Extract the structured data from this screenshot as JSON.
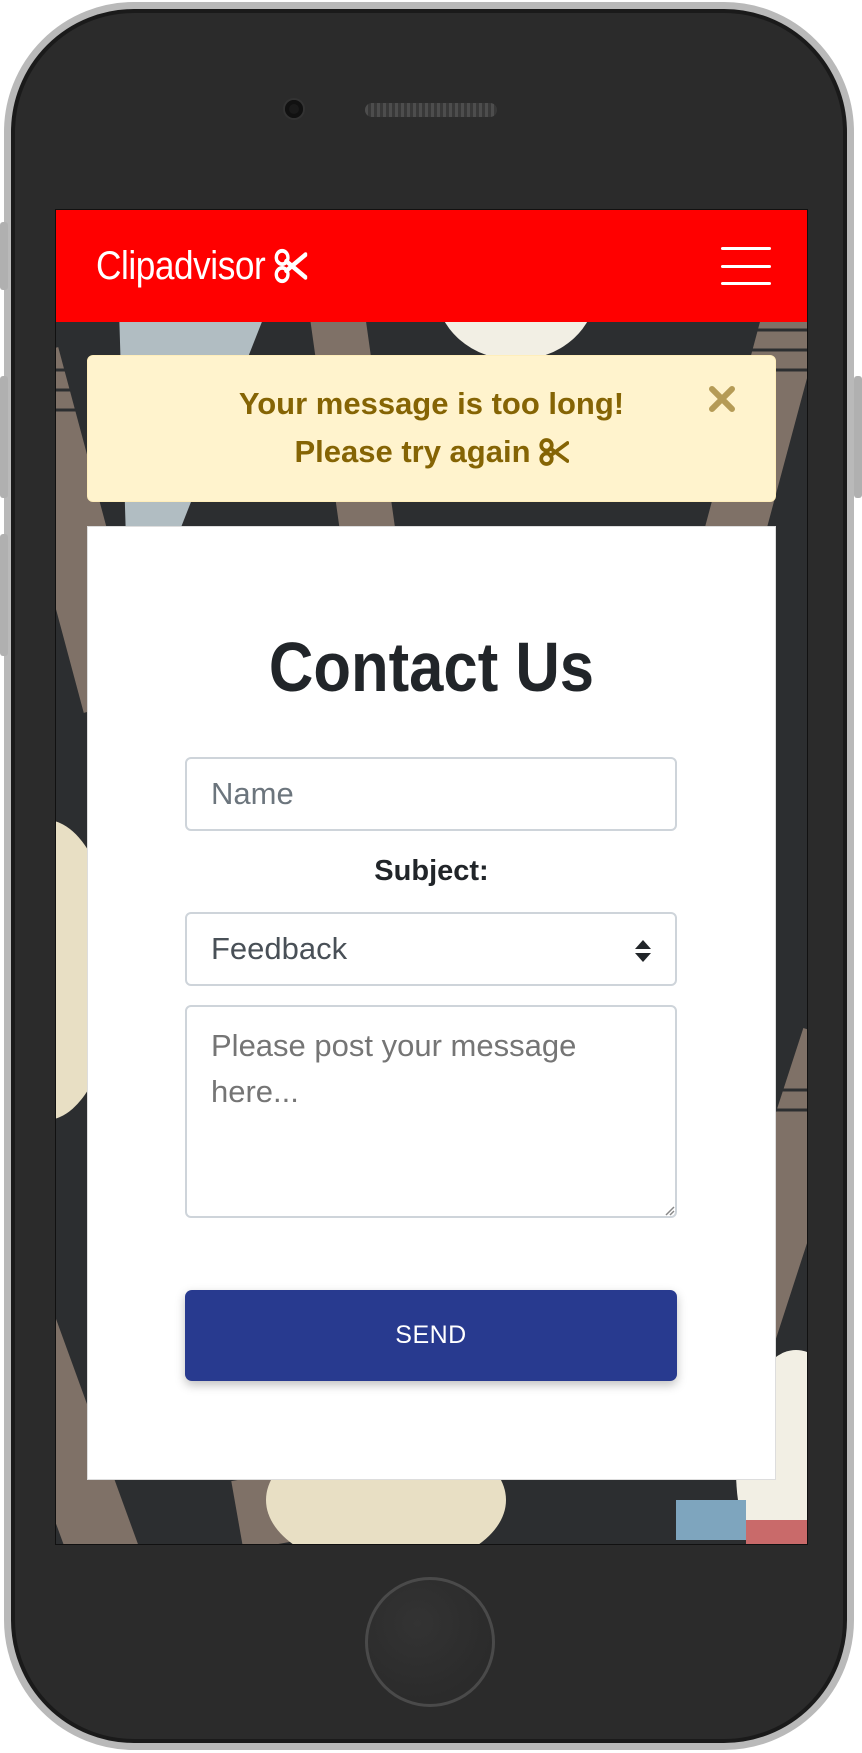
{
  "navbar": {
    "brand": "Clipadvisor",
    "brand_icon": "scissors-icon",
    "menu_icon": "hamburger-menu-icon",
    "background_color": "#ff0000"
  },
  "alert": {
    "line1": "Your message is too long!",
    "line2": "Please try again",
    "icon": "scissors-icon",
    "close_icon": "close-icon",
    "background_color": "#fff3cd",
    "text_color": "#856404"
  },
  "contact_form": {
    "title": "Contact Us",
    "name_placeholder": "Name",
    "subject_label": "Subject:",
    "subject_selected": "Feedback",
    "message_placeholder": "Please post your message here...",
    "send_label": "SEND",
    "send_color": "#283a8f"
  }
}
